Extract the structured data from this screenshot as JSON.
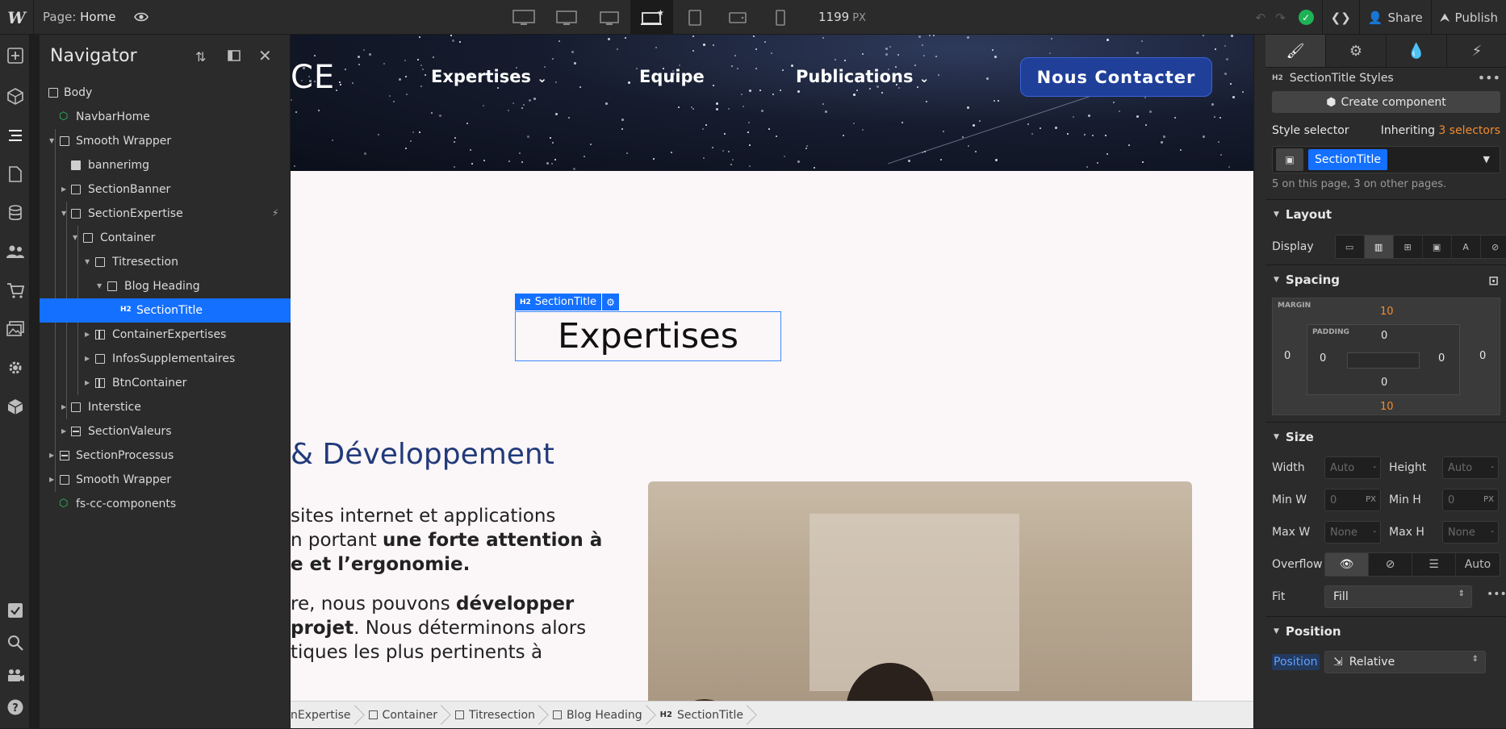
{
  "topbar": {
    "logo": "W",
    "page_prefix": "Page:",
    "page_name": "Home",
    "width_value": "1199",
    "width_unit": "PX",
    "share_label": "Share",
    "publish_label": "Publish"
  },
  "navigator": {
    "title": "Navigator",
    "items": [
      {
        "label": "Body"
      },
      {
        "label": "NavbarHome"
      },
      {
        "label": "Smooth Wrapper"
      },
      {
        "label": "bannerimg"
      },
      {
        "label": "SectionBanner"
      },
      {
        "label": "SectionExpertise"
      },
      {
        "label": "Container"
      },
      {
        "label": "Titresection"
      },
      {
        "label": "Blog Heading"
      },
      {
        "label": "SectionTitle"
      },
      {
        "label": "ContainerExpertises"
      },
      {
        "label": "InfosSupplementaires"
      },
      {
        "label": "BtnContainer"
      },
      {
        "label": "Interstice"
      },
      {
        "label": "SectionValeurs"
      },
      {
        "label": "SectionProcessus"
      },
      {
        "label": "Smooth Wrapper"
      },
      {
        "label": "fs-cc-components"
      }
    ]
  },
  "canvas": {
    "hero_logo": "CE",
    "nav_links": [
      "Expertises",
      "Equipe",
      "Publications"
    ],
    "cta_label": "Nous Contacter",
    "selected_tag": "H2",
    "selected_class": "SectionTitle",
    "heading": "Expertises",
    "subheading": "& Développement",
    "paragraph1": {
      "line1": "sites internet et applications",
      "line2_a": "n portant ",
      "line2_b": "une forte attention à",
      "line3": "e et l’ergonomie."
    },
    "paragraph2": {
      "line1_a": "re, nous pouvons ",
      "line1_b": "développer",
      "line2_a": "projet",
      "line2_b": ". Nous déterminons alors",
      "line3": "tiques les plus pertinents à"
    }
  },
  "breadcrumb": {
    "items": [
      "nExpertise",
      "Container",
      "Titresection",
      "Blog Heading",
      "SectionTitle"
    ],
    "h2_tag": "H2"
  },
  "style_panel": {
    "tag": "H2",
    "styles_title": "SectionTitle Styles",
    "create_component": "Create component",
    "selector_label": "Style selector",
    "inheriting_prefix": "Inheriting",
    "inheriting_count": "3 selectors",
    "selector_class": "SectionTitle",
    "selector_note": "5 on this page, 3 on other pages.",
    "layout_heading": "Layout",
    "display_label": "Display",
    "spacing_heading": "Spacing",
    "margin_label": "MARGIN",
    "padding_label": "PADDING",
    "margin": {
      "top": "10",
      "right": "0",
      "bottom": "10",
      "left": "0"
    },
    "padding": {
      "top": "0",
      "right": "0",
      "bottom": "0",
      "left": "0"
    },
    "size_heading": "Size",
    "width_label": "Width",
    "width_value": "Auto",
    "height_label": "Height",
    "height_value": "Auto",
    "minw_label": "Min W",
    "minw_value": "0",
    "minh_label": "Min H",
    "minh_value": "0",
    "maxw_label": "Max W",
    "maxw_value": "None",
    "maxh_label": "Max H",
    "maxh_value": "None",
    "px_unit": "PX",
    "dash": "-",
    "overflow_label": "Overflow",
    "overflow_auto": "Auto",
    "fit_label": "Fit",
    "fit_value": "Fill",
    "position_heading": "Position",
    "position_label": "Position",
    "position_value": "Relative"
  },
  "colors": {
    "accent": "#1470ff",
    "success": "#1eb256",
    "orange": "#f08c2e",
    "heading_blue": "#223a7a",
    "cta": "#1f3f99"
  }
}
